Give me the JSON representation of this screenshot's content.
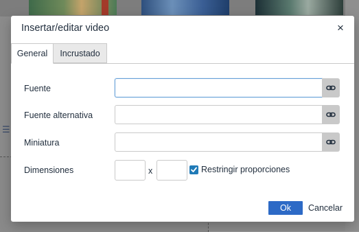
{
  "dialog": {
    "title": "Insertar/editar video",
    "close_icon": "close-icon",
    "tabs": [
      {
        "label": "General",
        "active": true
      },
      {
        "label": "Incrustado",
        "active": false
      }
    ],
    "fields": {
      "source": {
        "label": "Fuente",
        "value": "",
        "focused": true
      },
      "alt_source": {
        "label": "Fuente alternativa",
        "value": ""
      },
      "poster": {
        "label": "Miniatura",
        "value": ""
      }
    },
    "browse_icon": "link-icon",
    "dimensions": {
      "label": "Dimensiones",
      "width": "",
      "height": "",
      "separator": "x",
      "constrain_label": "Restringir proporciones",
      "constrain_checked": true
    },
    "buttons": {
      "ok": "Ok",
      "cancel": "Cancelar"
    }
  },
  "colors": {
    "accent": "#207ab7",
    "ok_button": "#2d6ac6",
    "focus_border": "#66a0d8",
    "overlay": "#8c8c8c"
  }
}
